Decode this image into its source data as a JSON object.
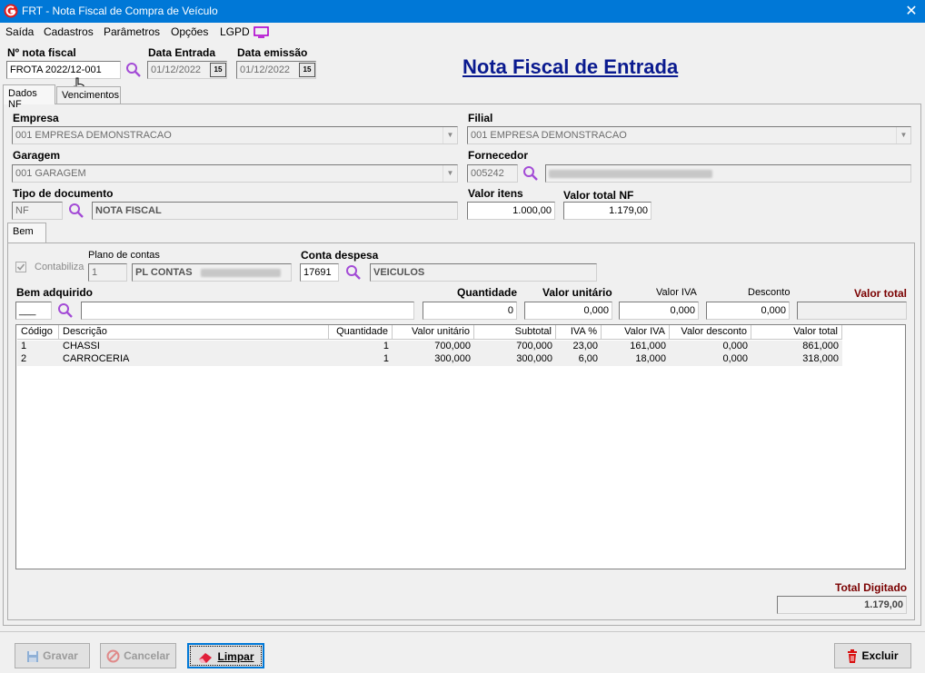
{
  "window": {
    "title": "FRT - Nota Fiscal de Compra de Veículo",
    "close": "✕"
  },
  "menu": [
    "Saída",
    "Cadastros",
    "Parâmetros",
    "Opções",
    "LGPD"
  ],
  "header": {
    "nota_label": "Nº nota fiscal",
    "nota_value": "FROTA 2022/12-001",
    "entrada_label": "Data Entrada",
    "entrada_value": "01/12/2022",
    "emissao_label": "Data emissão",
    "emissao_value": "01/12/2022",
    "cal_text": "15",
    "page_title": "Nota Fiscal de Entrada"
  },
  "tabs": [
    "Dados NF",
    "Vencimentos"
  ],
  "dados": {
    "empresa_label": "Empresa",
    "empresa_value": "001 EMPRESA DEMONSTRACAO",
    "filial_label": "Filial",
    "filial_value": "001 EMPRESA DEMONSTRACAO",
    "garagem_label": "Garagem",
    "garagem_value": "001 GARAGEM",
    "fornecedor_label": "Fornecedor",
    "fornecedor_code": "005242",
    "tipo_label": "Tipo de documento",
    "tipo_code": "NF",
    "tipo_desc": "NOTA FISCAL",
    "valor_itens_label": "Valor itens",
    "valor_itens_value": "1.000,00",
    "valor_total_label": "Valor total NF",
    "valor_total_value": "1.179,00"
  },
  "bem_tab": "Bem",
  "bem": {
    "contabiliza_label": "Contabiliza",
    "plano_label": "Plano de contas",
    "plano_code": "1",
    "plano_desc": "PL CONTAS",
    "conta_label": "Conta despesa",
    "conta_code": "17691",
    "conta_desc": "VEICULOS",
    "bem_label": "Bem adquirido",
    "bem_code": "___",
    "qtd_label": "Quantidade",
    "qtd_value": "0",
    "vu_label": "Valor unitário",
    "vu_value": "0,000",
    "iva_label": "Valor IVA",
    "iva_value": "0,000",
    "desc_label": "Desconto",
    "desc_value": "0,000",
    "vt_label": "Valor total"
  },
  "grid": {
    "headers": [
      "Código",
      "Descrição",
      "Quantidade",
      "Valor unitário",
      "Subtotal",
      "IVA %",
      "Valor  IVA",
      "Valor desconto",
      "Valor total"
    ],
    "rows": [
      [
        "1",
        "CHASSI",
        "1",
        "700,000",
        "700,000",
        "23,00",
        "161,000",
        "0,000",
        "861,000"
      ],
      [
        "2",
        "CARROCERIA",
        "1",
        "300,000",
        "300,000",
        "6,00",
        "18,000",
        "0,000",
        "318,000"
      ]
    ]
  },
  "total": {
    "label": "Total Digitado",
    "value": "1.179,00"
  },
  "buttons": {
    "gravar": "Gravar",
    "cancelar": "Cancelar",
    "limpar": "Limpar",
    "excluir": "Excluir"
  }
}
